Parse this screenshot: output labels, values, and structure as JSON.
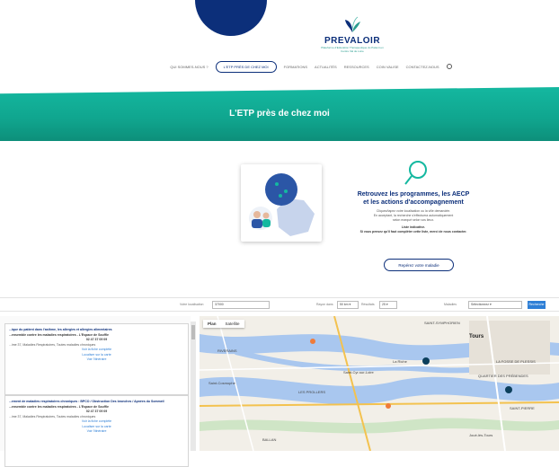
{
  "header": {
    "brand": "PREVALOIR",
    "tagline": "Plateforme d'Education Thérapeutique du Patient en Centre Val de Loire",
    "nav": [
      {
        "label": "QUI SOMMES-NOUS ?",
        "active": false
      },
      {
        "label": "L'ETP PRÈS DE CHEZ MOI",
        "active": true
      },
      {
        "label": "FORMATIONS",
        "active": false
      },
      {
        "label": "ACTUALITÉS",
        "active": false
      },
      {
        "label": "RESSOURCES",
        "active": false
      },
      {
        "label": "COIN VALISE",
        "active": false
      },
      {
        "label": "CONTACTEZ-NOUS",
        "active": false
      }
    ]
  },
  "hero": {
    "title": "L'ETP près de chez moi",
    "color": "#14b8a0"
  },
  "intro": {
    "title_line1": "Retrouvez les programmes, les AECP",
    "title_line2": "et les actions d'accompagnement",
    "body_line1": "Cliquez/tapez votre localisation ou la ville demandée.",
    "body_line2": "En acceptant, la recherche s'effectuera automatiquement",
    "body_line3": "selon marqué selon vos lieux.",
    "note1": "Liste indicative.",
    "note2": "Si vous pensez qu'il faut compléter cette liste, merci de nous contacter.",
    "button": "Repérez votre maladie"
  },
  "filters": {
    "location_label": "Votre localisation",
    "location_value": "37000",
    "radius_label": "Rayon dans",
    "radius_value": "50 km",
    "results_label": "Résultats",
    "results_value": "25",
    "disease_label": "Maladies",
    "disease_value": "Sélectionnez",
    "search_button": "Recherche"
  },
  "results": [
    {
      "title": "...ique du patient dans l'asthme, les allergies et allergies alimentaires",
      "org": "...ensemble contre les maladies respiratoires - L'Espace de Souffle",
      "phone": "02 47 37 09 09",
      "meta": "...ime 37, Maladies Respiratoires, Toutes maladies chroniques",
      "link1": "Voir la fiche complète",
      "link2": "Localiser sur la carte",
      "link3": "Voir l'itinéraire"
    },
    {
      "title": "...ement de maladies respiratoires chroniques : BPCO / Obstruction Des bronches / Apnées du Sommeil",
      "org": "...ensemble contre les maladies respiratoires - L'Espace de Souffle",
      "phone": "02 47 37 09 09",
      "meta": "...ime 37, Maladies Respiratoires, Toutes maladies chroniques",
      "link1": "Voir la fiche complète",
      "link2": "Localiser sur la carte",
      "link3": "Voir l'itinéraire"
    }
  ],
  "map": {
    "tabs": [
      "Plan",
      "Satellite"
    ],
    "labels": [
      "Tours",
      "La Riche",
      "Saint-Cyr-sur-Loire",
      "Saint-Cosmophe",
      "LES PROLLERS",
      "SAINT-SYMPHORIEN",
      "LA FOSSE DE PLESSIS",
      "QUARTIER DES PRÉBENDES",
      "Joué-lès-Tours",
      "SAINT-PIERRE",
      "BALLAN",
      "RIVERAINS"
    ]
  }
}
